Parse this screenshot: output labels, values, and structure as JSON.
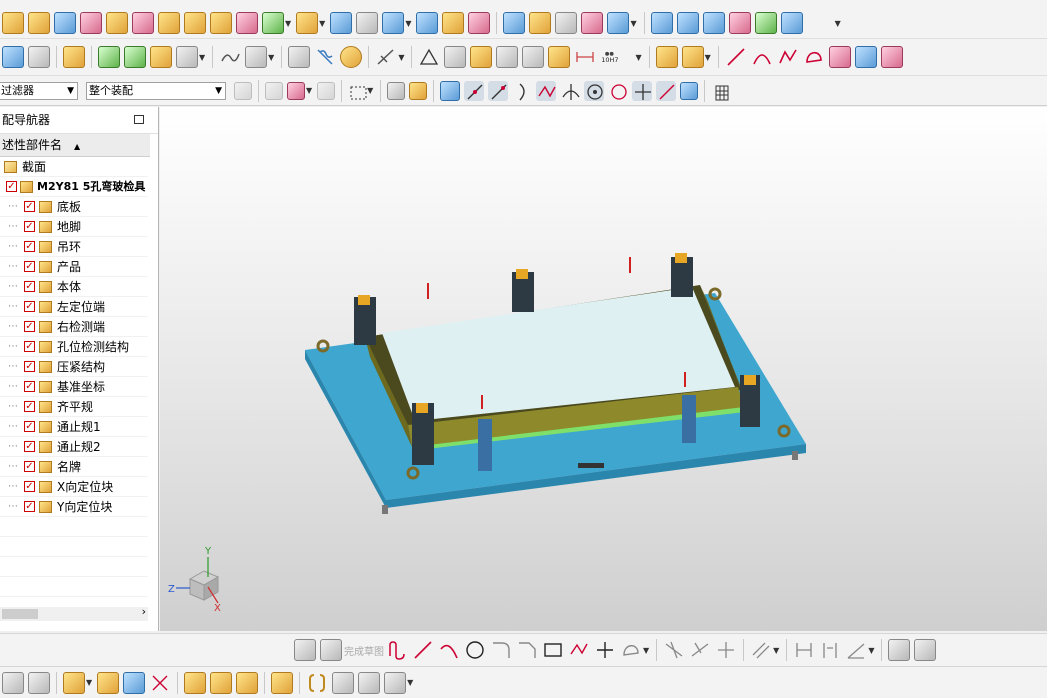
{
  "filter": {
    "type_filter": "过滤器",
    "selection_scope": "整个装配"
  },
  "navigator": {
    "title": "配导航器",
    "column_header": "述性部件名",
    "section_label": "截面",
    "root_assembly": "M2Y81 5孔弯玻检具",
    "components": [
      "底板",
      "地脚",
      "吊环",
      "产品",
      "本体",
      "左定位端",
      "右检测端",
      "孔位检测结构",
      "压紧结构",
      "基准坐标",
      "齐平规",
      "通止规1",
      "通止规2",
      "名牌",
      "X向定位块",
      "Y向定位块"
    ]
  },
  "toolbar": {
    "tolerance_label": "10H7",
    "sketch_finish_label": "完成草图"
  },
  "triad": {
    "x": "X",
    "y": "Y",
    "z": "Z"
  },
  "colors": {
    "base_plate": "#3ea6cf",
    "product_glass": "#dff0f2",
    "frame_olive": "#8e8a2c",
    "rail_green": "#7ee06a",
    "check_mark": "#cc0000",
    "viewport_top": "#ffffff",
    "viewport_bottom": "#cfcfcf"
  },
  "icons": [
    "block-icon",
    "cylinder-icon",
    "extrude-icon",
    "revolve-icon",
    "hole-icon",
    "pattern-icon",
    "boolean-icon",
    "edge-blend-icon",
    "chamfer-icon",
    "shell-icon",
    "sketch-icon",
    "measure-icon",
    "line-icon",
    "arc-icon",
    "circle-icon",
    "point-icon",
    "spline-icon",
    "rectangle-icon",
    "snap-icon",
    "assembly-icon"
  ]
}
